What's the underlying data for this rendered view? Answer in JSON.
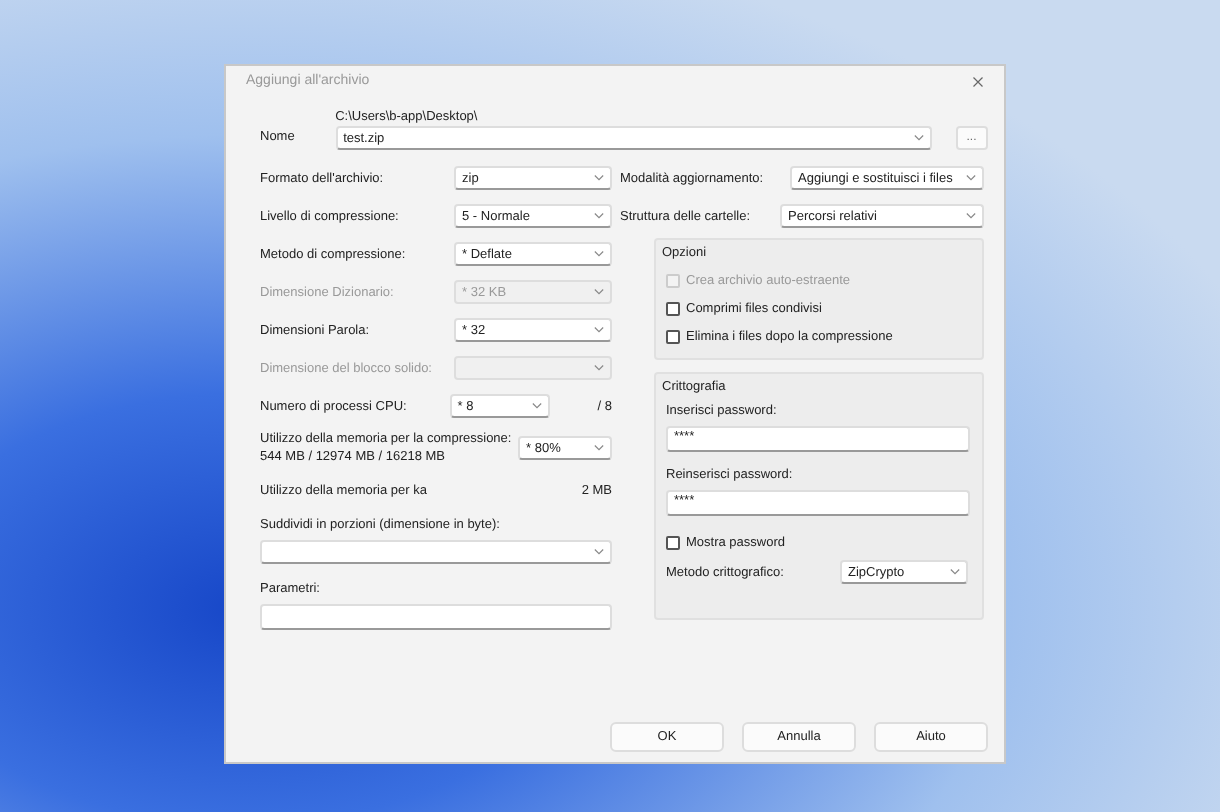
{
  "window": {
    "title": "Aggiungi all'archivio"
  },
  "name": {
    "label": "Nome",
    "path": "C:\\Users\\b-app\\Desktop\\",
    "value": "test.zip",
    "browse": "..."
  },
  "left": [
    {
      "kind": "combo",
      "label": "Formato dell'archivio:",
      "value": "zip",
      "disabled": false
    },
    {
      "kind": "combo",
      "label": "Livello di compressione:",
      "value": "5 - Normale",
      "disabled": false
    },
    {
      "kind": "combo",
      "label": "Metodo di compressione:",
      "value": "* Deflate",
      "disabled": false
    },
    {
      "kind": "combo",
      "label": "Dimensione Dizionario:",
      "value": "* 32 KB",
      "disabled": true
    },
    {
      "kind": "combo",
      "label": "Dimensioni Parola:",
      "value": "* 32",
      "disabled": false
    },
    {
      "kind": "combo",
      "label": "Dimensione del blocco solido:",
      "disabled": true
    },
    {
      "kind": "cpu",
      "label": "Numero di processi CPU:",
      "value": "* 8",
      "extra": "/ 8",
      "disabled": false
    },
    {
      "kind": "memory",
      "label": "Utilizzo della memoria per la compressione:",
      "detail": "544 MB / 12974 MB / 16218 MB",
      "value": "* 80%",
      "disabled": false
    },
    {
      "kind": "info",
      "label": "Utilizzo della memoria per ka",
      "extra": "2 MB"
    },
    {
      "kind": "widecombo",
      "label": "Suddividi in porzioni (dimensione in byte):"
    },
    {
      "kind": "field",
      "label": "Parametri:"
    }
  ],
  "right": [
    {
      "label": "Modalità aggiornamento:",
      "value": "Aggiungi e sostituisci i files"
    },
    {
      "label": "Struttura delle cartelle:",
      "value": "Percorsi relativi"
    }
  ],
  "options": {
    "title": "Opzioni",
    "items": [
      {
        "label": "Crea archivio auto-estraente",
        "checked": false,
        "disabled": true
      },
      {
        "label": "Comprimi files condivisi",
        "checked": false,
        "disabled": false
      },
      {
        "label": "Elimina i files dopo la compressione",
        "checked": false,
        "disabled": false
      }
    ]
  },
  "encryption": {
    "title": "Crittografia",
    "password_label": "Inserisci password:",
    "password": "****",
    "repeat_label": "Reinserisci password:",
    "repeat": "****",
    "show": {
      "label": "Mostra password",
      "checked": false
    },
    "method_label": "Metodo crittografico:",
    "method": "ZipCrypto"
  },
  "buttons": [
    "OK",
    "Annulla",
    "Aiuto"
  ]
}
